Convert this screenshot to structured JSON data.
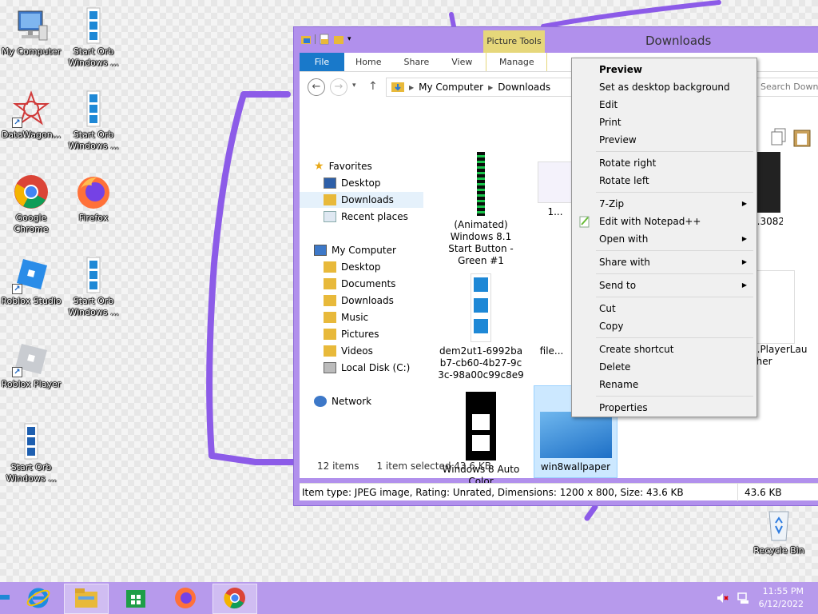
{
  "desktop": {
    "icons": [
      {
        "label": "My Computer"
      },
      {
        "label": "Start Orb\nWindows ..."
      },
      {
        "label": "DataWagon..."
      },
      {
        "label": "Start Orb\nWindows ..."
      },
      {
        "label": "Google\nChrome"
      },
      {
        "label": "Firefox"
      },
      {
        "label": "Roblox Studio"
      },
      {
        "label": "Start Orb\nWindows ..."
      },
      {
        "label": "Roblox Player"
      },
      {
        "label": "Start Orb\nWindows ..."
      },
      {
        "label": "Recycle Bin"
      }
    ]
  },
  "window": {
    "title": "Downloads",
    "context_tab_group": "Picture Tools",
    "tabs": [
      "File",
      "Home",
      "Share",
      "View",
      "Manage"
    ],
    "breadcrumb": [
      "My Computer",
      "Downloads"
    ],
    "search_placeholder": "Search Down",
    "nav": {
      "favorites": "Favorites",
      "fav_items": [
        "Desktop",
        "Downloads",
        "Recent places"
      ],
      "computer": "My Computer",
      "computer_items": [
        "Desktop",
        "Documents",
        "Downloads",
        "Music",
        "Pictures",
        "Videos",
        "Local Disk (C:)"
      ],
      "network": "Network"
    },
    "files": [
      {
        "name": "(Animated)\nWindows 8.1\nStart Button -\nGreen #1"
      },
      {
        "name": "1..."
      },
      {
        "name": "...30821"
      },
      {
        "name": "dem2ut1-6992ba\nb7-cb60-4b27-9c\n3c-98a00c99c8e9"
      },
      {
        "name": "file..."
      },
      {
        "name": "...PlayerLau\ncher"
      },
      {
        "name": "Windows 8 Auto\nColor"
      },
      {
        "name": "win8wallpaper"
      }
    ],
    "status": {
      "count": "12 items",
      "selected": "1 item selected  43.6 KB"
    },
    "details": {
      "text": "Item type: JPEG image, Rating: Unrated, Dimensions: 1200 x 800, Size: 43.6 KB",
      "size": "43.6 KB"
    }
  },
  "context_menu": {
    "items": [
      {
        "label": "Preview",
        "bold": true
      },
      {
        "label": "Set as desktop background"
      },
      {
        "label": "Edit"
      },
      {
        "label": "Print"
      },
      {
        "label": "Preview"
      },
      {
        "label": "Rotate right"
      },
      {
        "label": "Rotate left"
      },
      {
        "label": "7-Zip"
      },
      {
        "label": "Edit with Notepad++"
      },
      {
        "label": "Open with"
      },
      {
        "label": "Share with"
      },
      {
        "label": "Send to"
      },
      {
        "label": "Cut"
      },
      {
        "label": "Copy"
      },
      {
        "label": "Create shortcut"
      },
      {
        "label": "Delete"
      },
      {
        "label": "Rename"
      },
      {
        "label": "Properties"
      }
    ]
  },
  "taskbar": {
    "time": "11:55 PM",
    "date": "6/12/2022"
  },
  "colors": {
    "accent": "#b190ec",
    "file_tab": "#1979ca",
    "scribble": "#8c5be8",
    "selection": "#cce8ff"
  }
}
